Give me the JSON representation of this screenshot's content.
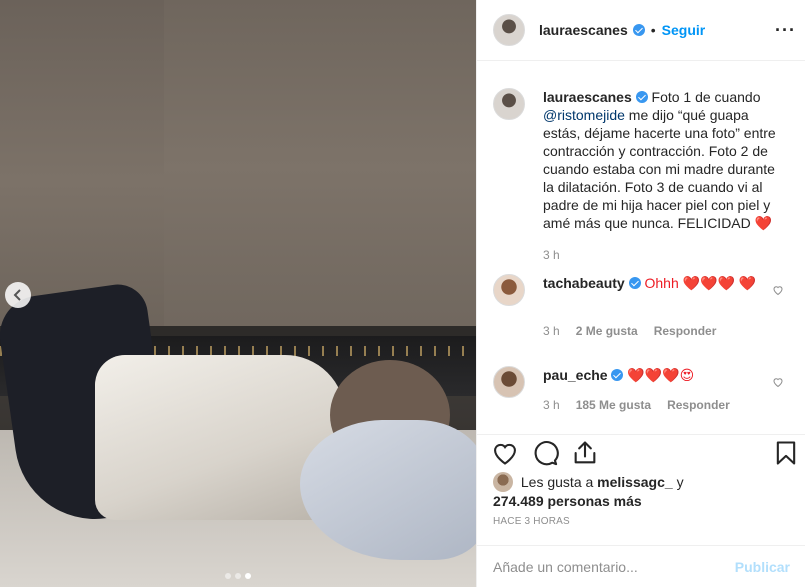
{
  "post": {
    "photo": {
      "description_hidden": false,
      "carousel_dots": 3,
      "active_dot": 2
    },
    "header": {
      "username": "lauraescanes",
      "separator": "•",
      "follow_label": "Seguir",
      "more_icon": "···"
    },
    "caption": {
      "username": "lauraescanes",
      "text_part1": "Foto 1 de cuando",
      "mention": "@ristomejide",
      "text_part2": "me dijo “qué guapa estás, déjame hacerte una foto” entre contracción y contracción. Foto 2 de cuando estaba con mi madre durante la dilatación. Foto 3 de cuando vi al padre de mi hija hacer piel con piel y amé más que nunca. FELICIDAD",
      "emoji": "❤️",
      "time": "3 h"
    },
    "comments": [
      {
        "username": "tachabeauty",
        "text": "Ohhh ❤️❤️❤️ ❤️",
        "time": "3 h",
        "likes": "2 Me gusta",
        "reply": "Responder"
      },
      {
        "username": "pau_eche",
        "text": "❤️❤️❤️😍",
        "time": "3 h",
        "likes": "185 Me gusta",
        "reply": "Responder"
      }
    ],
    "likes": {
      "prefix": "Les gusta a",
      "first_user": "melissagc_",
      "conjunction": "y",
      "count": "274.489 personas más"
    },
    "posted": "HACE 3 HORAS",
    "add_comment": {
      "placeholder": "Añade un comentario...",
      "publish_label": "Publicar"
    },
    "colors": {
      "accent": "#0095f6",
      "verified": "#3897f0",
      "muted": "#8e8e8e",
      "publish_disabled": "#b2dffc",
      "heart": "#ed1c24"
    }
  }
}
